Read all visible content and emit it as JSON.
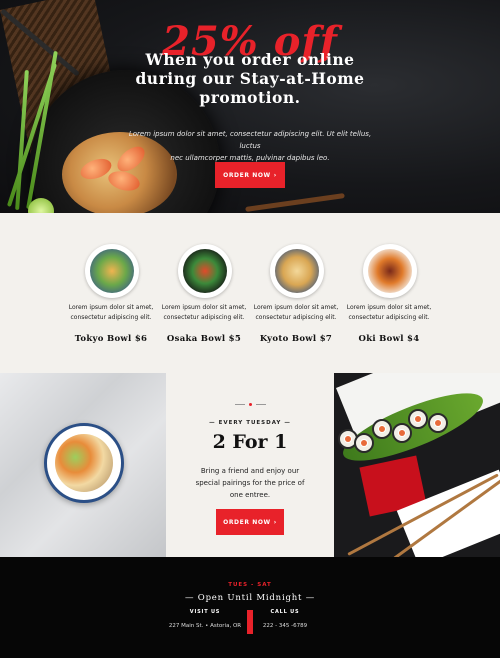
{
  "hero": {
    "highlight": "25% off",
    "title_line1": "When you order online",
    "title_line2": "during our Stay-at-Home",
    "title_line3": "promotion.",
    "body_line1": "Lorem ipsum dolor sit amet, consectetur adipiscing elit. Ut elit tellus, luctus",
    "body_line2": "nec ullamcorper mattis, pulvinar dapibus leo.",
    "button_label": "ORDER NOW",
    "button_icon": "chevron-right-icon"
  },
  "menu": {
    "items": [
      {
        "desc_line1": "Lorem ipsum dolor sit amet,",
        "desc_line2": "consectetur adipiscing elit.",
        "name": "Tokyo Bowl $6"
      },
      {
        "desc_line1": "Lorem ipsum dolor sit amet,",
        "desc_line2": "consectetur adipiscing elit.",
        "name": "Osaka Bowl $5"
      },
      {
        "desc_line1": "Lorem ipsum dolor sit amet,",
        "desc_line2": "consectetur adipiscing elit.",
        "name": "Kyoto Bowl $7"
      },
      {
        "desc_line1": "Lorem ipsum dolor sit amet,",
        "desc_line2": "consectetur adipiscing elit.",
        "name": "Oki Bowl $4"
      }
    ]
  },
  "special": {
    "day": "— EVERY TUESDAY —",
    "title": "2 For 1",
    "body_line1": "Bring a friend and enjoy our",
    "body_line2": "special pairings for the price of",
    "body_line3": "one entree.",
    "button_label": "ORDER NOW"
  },
  "footer": {
    "days": "TUES - SAT",
    "title": "— Open Until Midnight —",
    "visit_label": "VISIT US",
    "visit_value": "227 Main St. • Astoria, OR",
    "call_label": "CALL US",
    "call_value": "222 - 345 -6789"
  },
  "colors": {
    "accent": "#e8222a",
    "dark": "#0b0b0d",
    "cream": "#f3f1ed"
  }
}
